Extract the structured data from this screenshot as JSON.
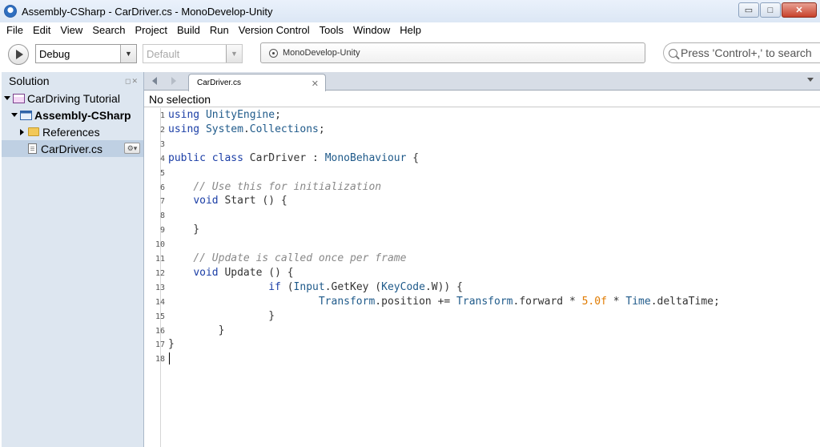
{
  "window": {
    "title": "Assembly-CSharp - CarDriver.cs - MonoDevelop-Unity",
    "buttons": {
      "minimize": "▭",
      "maximize": "□",
      "close": "✕"
    }
  },
  "menu": [
    "File",
    "Edit",
    "View",
    "Search",
    "Project",
    "Build",
    "Run",
    "Version Control",
    "Tools",
    "Window",
    "Help"
  ],
  "toolbar": {
    "configuration": "Debug",
    "platform": "Default",
    "status": "MonoDevelop-Unity",
    "search_placeholder": "Press 'Control+,' to search"
  },
  "solution_pad": {
    "title": "Solution",
    "header_buttons": "◻✕",
    "tree": [
      {
        "label": "CarDriving Tutorial",
        "type": "solution",
        "expanded": true
      },
      {
        "label": "Assembly-CSharp",
        "type": "project",
        "expanded": true,
        "bold": true
      },
      {
        "label": "References",
        "type": "folder",
        "expanded": false
      },
      {
        "label": "CarDriver.cs",
        "type": "file",
        "selected": true
      }
    ],
    "row_options": "⚙▾"
  },
  "editor": {
    "tab_label": "CarDriver.cs",
    "tab_close": "✕",
    "breadcrumb": "No selection",
    "cursor_line": 18,
    "lines": [
      {
        "n": "1",
        "text": "using UnityEngine;"
      },
      {
        "n": "2",
        "text": "using System.Collections;"
      },
      {
        "n": "3",
        "text": ""
      },
      {
        "n": "4",
        "text": "public class CarDriver : MonoBehaviour {"
      },
      {
        "n": "5",
        "text": ""
      },
      {
        "n": "6",
        "text": "    // Use this for initialization"
      },
      {
        "n": "7",
        "text": "    void Start () {"
      },
      {
        "n": "8",
        "text": ""
      },
      {
        "n": "9",
        "text": "    }"
      },
      {
        "n": "10",
        "text": ""
      },
      {
        "n": "11",
        "text": "    // Update is called once per frame"
      },
      {
        "n": "12",
        "text": "    void Update () {"
      },
      {
        "n": "13",
        "text": "                if (Input.GetKey (KeyCode.W)) {"
      },
      {
        "n": "14",
        "text": "                        Transform.position += Transform.forward * 5.0f * Time.deltaTime;"
      },
      {
        "n": "15",
        "text": "                }"
      },
      {
        "n": "16",
        "text": "        }"
      },
      {
        "n": "17",
        "text": "}"
      },
      {
        "n": "18",
        "text": ""
      }
    ]
  },
  "colors": {
    "keyword": "#1b3ea6",
    "type": "#1f5a8a",
    "comment": "#888888",
    "number": "#e07b00",
    "solution_pad_bg": "#dde6f0",
    "selection": "#bfd0e3"
  },
  "icons": {
    "app": "monodevelop-icon",
    "run": "play-icon",
    "status": "status-icon",
    "search": "search-icon",
    "solution": "solution-icon",
    "project": "project-icon",
    "folder": "folder-icon",
    "file": "cs-file-icon"
  }
}
